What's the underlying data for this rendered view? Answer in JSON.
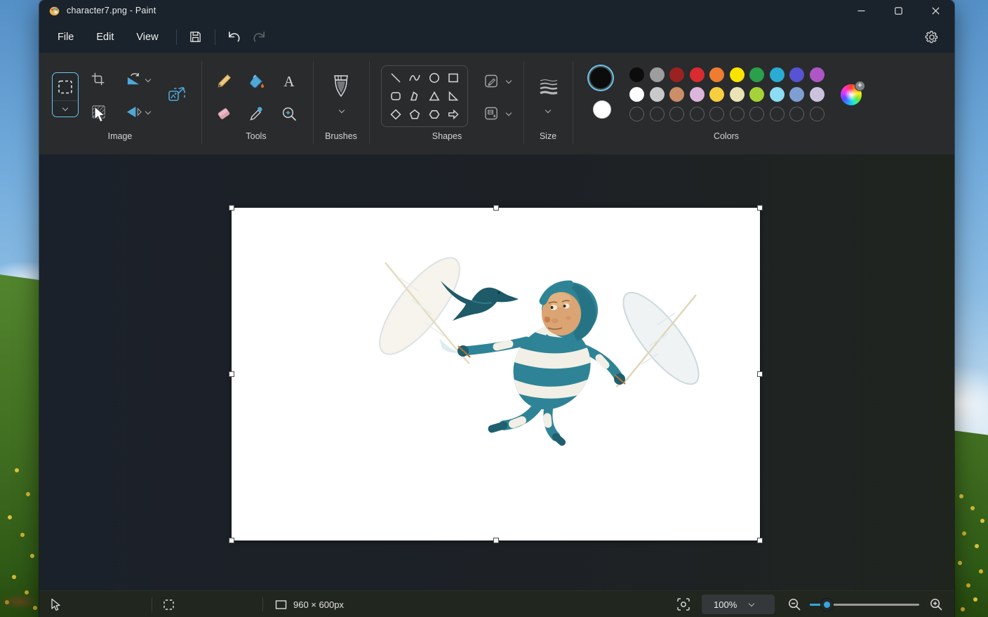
{
  "titlebar": {
    "title": "character7.png - Paint",
    "app_icon": "paint-palette-icon",
    "controls": [
      "minimize",
      "maximize",
      "close"
    ]
  },
  "menubar": {
    "items": [
      "File",
      "Edit",
      "View"
    ],
    "quick_actions": [
      "save",
      "undo",
      "redo"
    ],
    "redo_disabled": true,
    "settings_icon": "gear-icon"
  },
  "ribbon": {
    "sections": [
      {
        "label": "Image"
      },
      {
        "label": "Tools"
      },
      {
        "label": "Brushes"
      },
      {
        "label": "Shapes"
      },
      {
        "label": "Size"
      },
      {
        "label": "Colors"
      }
    ],
    "image_tools": [
      "select",
      "crop",
      "rotate",
      "remove-background",
      "flip",
      "resize"
    ],
    "tool_items": [
      "pencil",
      "fill",
      "text",
      "eraser",
      "color-picker",
      "magnifier"
    ],
    "shape_items": [
      "line",
      "curve",
      "oval",
      "rectangle",
      "rounded-rectangle",
      "polygon",
      "triangle",
      "right-triangle",
      "diamond",
      "pentagon",
      "hexagon",
      "arrow"
    ],
    "shape_style_buttons": [
      "outline",
      "fill"
    ]
  },
  "colors": {
    "color1": "#0c0c0c",
    "color2": "#ffffff",
    "selection_ring": "#6cc4ea",
    "palette_rows": [
      [
        "#0c0c0c",
        "#9d9d9d",
        "#9c2121",
        "#d92b30",
        "#ee7d31",
        "#fbe300",
        "#2aa04a",
        "#29abd4",
        "#5753d5",
        "#ae56c5"
      ],
      [
        "#ffffff",
        "#c9c9c9",
        "#ca8f68",
        "#dcb6da",
        "#f7cf3e",
        "#e9e3b5",
        "#a4d337",
        "#8cdcf3",
        "#7f9fd3",
        "#cbc3dd"
      ]
    ],
    "empty_slot_count": 10,
    "edit_colors_icon": "color-wheel-plus"
  },
  "canvas": {
    "selection_active": true,
    "handle_count": 8,
    "image_description": "teal-and-white striped fairy character flying, holding a large white feather in each hand, with a small teal bird at upper left"
  },
  "statusbar": {
    "canvas_size": "960 × 600px",
    "zoom_level": "100%",
    "left_indicators": [
      "cursor-position",
      "selection-size",
      "canvas-size"
    ],
    "right_controls": [
      "fit-to-screen",
      "zoom-dropdown",
      "zoom-out",
      "zoom-slider",
      "zoom-in"
    ]
  }
}
